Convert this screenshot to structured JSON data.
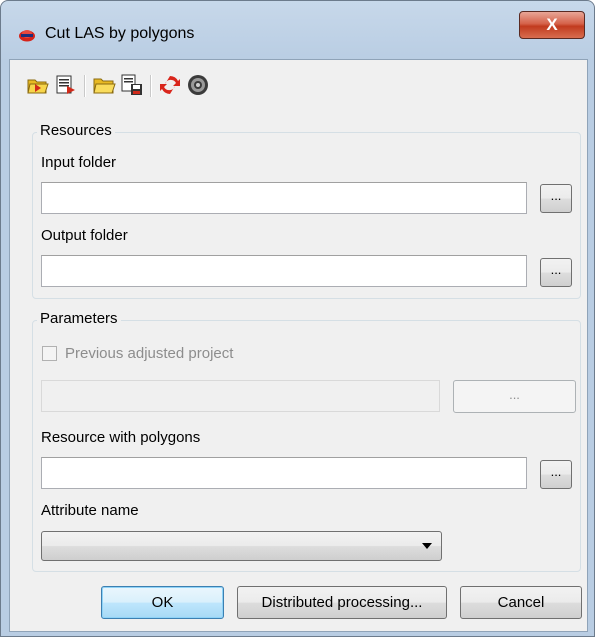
{
  "window": {
    "title": "Cut LAS by polygons",
    "close_label": "X"
  },
  "toolbar": {
    "icons": [
      "open-icon",
      "save-icon",
      "open-folder-icon",
      "save-as-icon",
      "refresh-icon",
      "settings-icon"
    ]
  },
  "resources": {
    "group_title": "Resources",
    "input_folder_label": "Input folder",
    "input_folder_value": "",
    "output_folder_label": "Output folder",
    "output_folder_value": "",
    "browse_label": "..."
  },
  "parameters": {
    "group_title": "Parameters",
    "previous_project_label": "Previous adjusted project",
    "previous_project_checked": false,
    "previous_project_value": "",
    "polygons_label": "Resource with polygons",
    "polygons_value": "",
    "attribute_label": "Attribute name",
    "attribute_value": "",
    "browse_label": "..."
  },
  "buttons": {
    "ok": "OK",
    "distributed": "Distributed processing...",
    "cancel": "Cancel"
  }
}
